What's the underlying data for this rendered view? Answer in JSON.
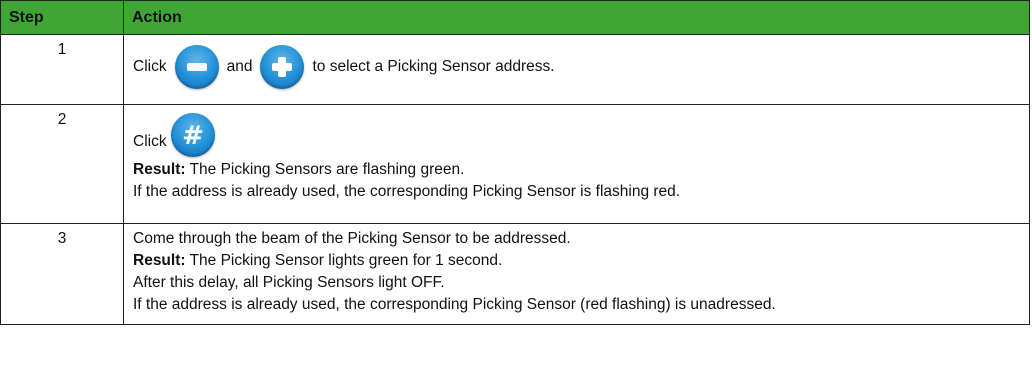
{
  "table": {
    "headers": {
      "step": "Step",
      "action": "Action"
    },
    "rows": [
      {
        "step": "1",
        "click": "Click",
        "and": "and",
        "tail": "to select a Picking Sensor address."
      },
      {
        "step": "2",
        "click": "Click",
        "result_label": "Result:",
        "result_text": " The Picking Sensors are flashing green.",
        "note": "If the address is already used, the corresponding Picking Sensor is flashing red."
      },
      {
        "step": "3",
        "line1": "Come through the beam of the Picking Sensor to be addressed.",
        "result_label": "Result:",
        "result_text": " The Picking Sensor lights green for 1 second.",
        "line3": "After this delay, all Picking Sensors light OFF.",
        "line4": "If the address is already used, the corresponding Picking Sensor (red flashing) is unadressed."
      }
    ]
  },
  "icons": {
    "minus": "minus-button-icon",
    "plus": "plus-button-icon",
    "hash": "hash-button-icon",
    "color": "#1f8fd8"
  },
  "colors": {
    "header_bg": "#3fa535"
  }
}
